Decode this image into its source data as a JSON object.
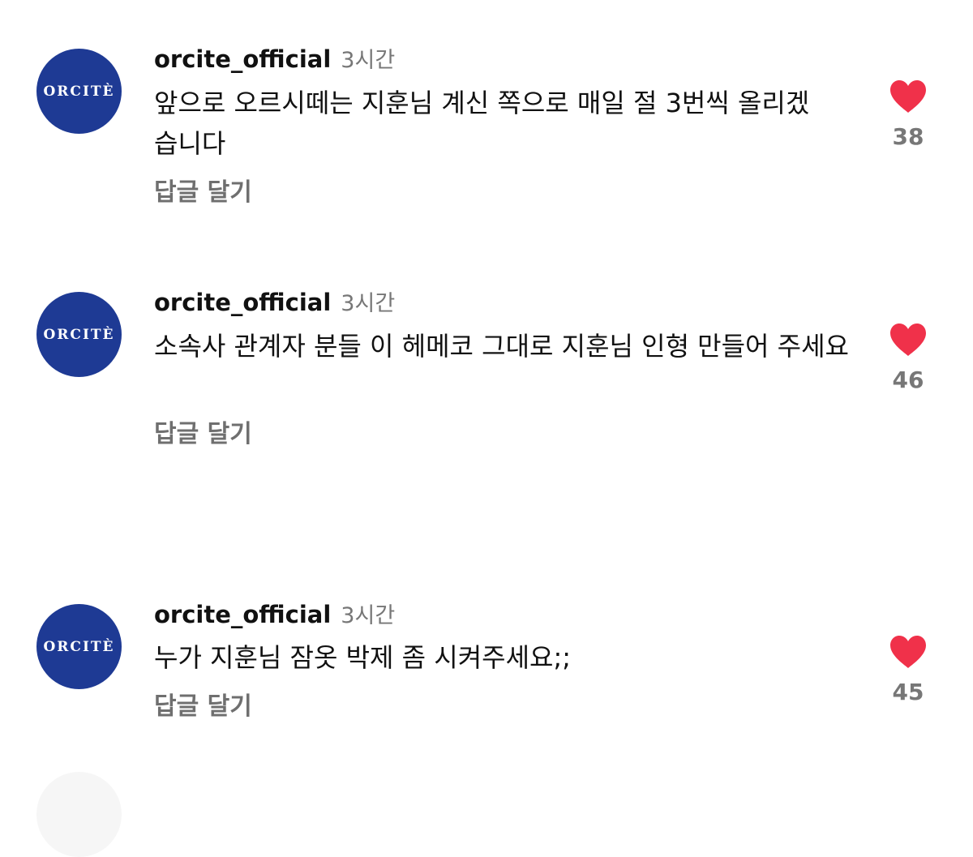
{
  "comments": [
    {
      "avatar_text": "ORCITÈ",
      "username": "orcite_official",
      "time": "3시간",
      "text": "앞으로 오르시떼는 지훈님 계신 쪽으로 매일 절 3번씩 올리겠습니다",
      "reply_label": "답글 달기",
      "likes": "38"
    },
    {
      "avatar_text": "ORCITÈ",
      "username": "orcite_official",
      "time": "3시간",
      "text": "소속사 관계자 분들 이 헤메코 그대로 지훈님 인형 만들어 주세요",
      "reply_label": "답글 달기",
      "likes": "46"
    },
    {
      "avatar_text": "ORCITÈ",
      "username": "orcite_official",
      "time": "3시간",
      "text": "누가 지훈님 잠옷 박제 좀 시켜주세요;;",
      "reply_label": "답글 달기",
      "likes": "45"
    }
  ],
  "colors": {
    "avatar_bg": "#1e3a94",
    "heart": "#f0314a",
    "muted": "#777777"
  },
  "icons": {
    "like": "heart-icon"
  }
}
